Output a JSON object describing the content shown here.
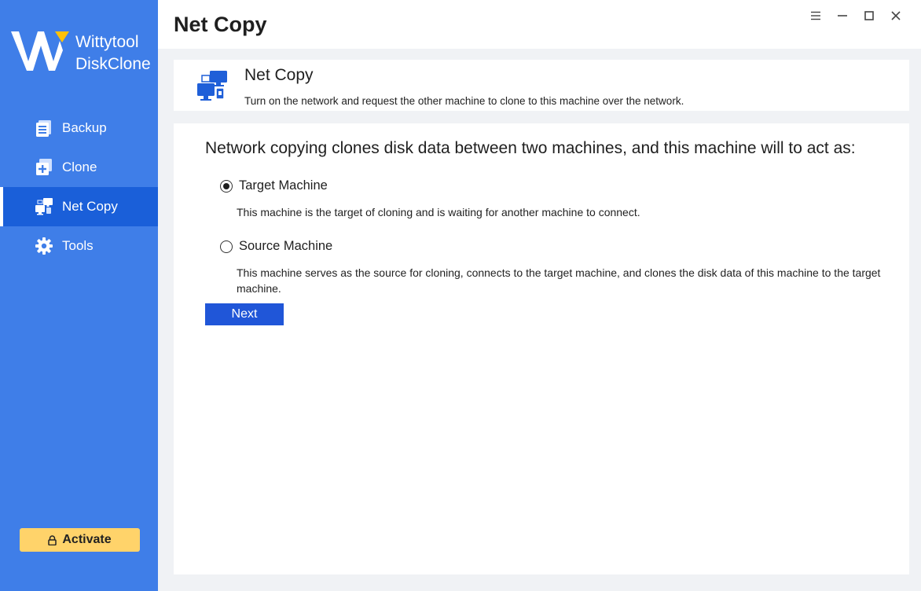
{
  "app": {
    "brand_line1": "Wittytool",
    "brand_line2": "DiskClone"
  },
  "sidebar": {
    "items": [
      {
        "label": "Backup",
        "icon": "backup-icon",
        "active": false
      },
      {
        "label": "Clone",
        "icon": "clone-icon",
        "active": false
      },
      {
        "label": "Net Copy",
        "icon": "net-copy-icon",
        "active": true
      },
      {
        "label": "Tools",
        "icon": "gear-icon",
        "active": false
      }
    ],
    "activate_label": "Activate"
  },
  "titlebar": {
    "title": "Net Copy",
    "controls": [
      "menu-icon",
      "minimize-icon",
      "maximize-icon",
      "close-icon"
    ]
  },
  "header": {
    "title": "Net Copy",
    "description": "Turn on the network and request the other machine to clone to this machine over the network."
  },
  "content": {
    "question": "Network copying clones disk data between two machines, and this machine will to act as:",
    "options": [
      {
        "label": "Target Machine",
        "selected": true,
        "description": "This machine is the target of cloning and is waiting for another machine to connect."
      },
      {
        "label": "Source Machine",
        "selected": false,
        "description": "This machine serves as the source for cloning, connects to the target machine, and clones the disk data of this machine to the target machine."
      }
    ],
    "next_label": "Next"
  },
  "colors": {
    "sidebar_bg": "#3f7ee8",
    "sidebar_active": "#1a5fd9",
    "accent_button": "#2056d8",
    "activate_bg": "#ffd36a",
    "logo_accent": "#ffc107"
  }
}
